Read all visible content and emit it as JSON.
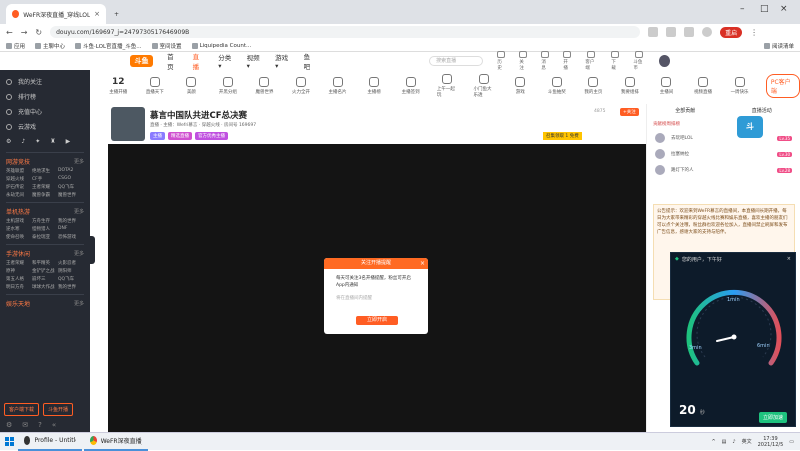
{
  "browser": {
    "tabs": [
      {
        "title": "WeFR深夜直播_穿线LOL比直播_斗鱼",
        "active": false
      },
      {
        "title": "",
        "active": true
      }
    ],
    "url": "douyu.com/169697_j=2479730517646909B",
    "restart_label": "重启",
    "bookmarks": [
      "应用",
      "主聊中心",
      "斗鱼·LOL官直播_斗鱼...",
      "室间设置",
      "Liquipedia Count..."
    ],
    "reading_list": "阅读清单"
  },
  "site": {
    "logo": "斗鱼",
    "nav": [
      {
        "label": "首页",
        "active": false
      },
      {
        "label": "直播",
        "active": true
      },
      {
        "label": "分类▾",
        "active": false
      },
      {
        "label": "视频▾",
        "active": false
      },
      {
        "label": "游戏▾",
        "active": false
      },
      {
        "label": "鱼吧",
        "active": false
      }
    ],
    "search_placeholder": "搜索直播",
    "header_icons": [
      "历史",
      "关注",
      "消息",
      "开播",
      "客户端",
      "下载",
      "斗鱼币"
    ]
  },
  "sidebar": {
    "items": [
      "我的关注",
      "排行榜",
      "充值中心",
      "云游戏"
    ],
    "sections": [
      {
        "title": "网游竞技",
        "more": "更多",
        "items": [
          "英雄联盟",
          "绝地求生",
          "DOTA2",
          "穿越火线",
          "CF手",
          "CSGO",
          "炉石传说",
          "王者荣耀",
          "QQ飞车",
          "永劫无间",
          "魔兽争霸",
          "魔兽世界"
        ]
      },
      {
        "title": "单机热游",
        "more": "更多",
        "items": [
          "主机游戏",
          "方舟生存",
          "我的世界",
          "逆水寒",
          "怪物猎人",
          "DNF",
          "使命召唤",
          "泰拉瑞亚",
          "恐怖游戏"
        ]
      },
      {
        "title": "手游休闲",
        "more": "更多",
        "items": [
          "王者荣耀",
          "和平精英",
          "火影忍者",
          "原神",
          "金铲铲之战",
          "阴阳师",
          "第五人格",
          "崩坏三",
          "QQ飞车",
          "明日方舟",
          "球球大作战",
          "我的世界"
        ]
      },
      {
        "title": "娱乐天地",
        "more": "更多",
        "items": []
      }
    ],
    "buttons": [
      "客户端下载",
      "斗鱼开播"
    ]
  },
  "categories": {
    "count": "12",
    "count_label": "主播开播",
    "items": [
      "直播天下",
      "美颜",
      "开黑分组",
      "魔兽世界",
      "火力全开",
      "主播名片",
      "主播榜",
      "主播签到",
      "上午一起玩",
      "小门鱼大乐透",
      "游戏",
      "斗鱼抽奖",
      "我的主页",
      "我要组排",
      "主播间",
      "视频直播",
      "一周快乐",
      "更多"
    ],
    "pc_button": "PC客户端"
  },
  "room": {
    "title": "慕言中国队共进CF总决赛",
    "subtitle": "直播 · 主播：Wefri慕言 · 穿越火线 · 房间号 169697",
    "tags": [
      "主播",
      "精选直播",
      "官方优秀主播"
    ],
    "banner": "召集领取 1 免费",
    "fans": "4875",
    "follow_label": "+关注"
  },
  "modal": {
    "title": "关注开播提醒",
    "body": "每天可关注3名开播提醒，粉丝可开启App内通知",
    "hint": "将在直播间内提醒",
    "button": "立即开启"
  },
  "right_panel": {
    "tabs": [
      "全部贡献",
      "直播活动"
    ],
    "rank_title": "贡献榜周排榜",
    "rows": [
      {
        "name": "去玩吧LOL",
        "level": "Lv.35"
      },
      {
        "name": "拉塞纳拉",
        "level": "Lv.30"
      },
      {
        "name": "路灯下的人",
        "level": "Lv.28"
      }
    ],
    "notice": "公告提示：欢迎来到WeFR慕言的直播间，本直播间长期开播，每日为大家带来精彩的穿越火线比赛和娱乐直播，喜欢主播的朋友们可以点个关注哦，粉丝群也欢迎各位加入，直播间禁止刷屏和发布广告信息，感谢大家的支持与陪伴。"
  },
  "speed_widget": {
    "title": "您的用户，下午好",
    "close": "×",
    "gauge_labels": [
      "1min",
      "3min",
      "6min"
    ],
    "value": "20",
    "unit": "秒",
    "button": "立即加速"
  },
  "taskbar": {
    "items": [
      {
        "label": "Profile - Untitled -...",
        "color": "#333"
      },
      {
        "label": "WeFR深夜直播_穿...",
        "color": "#4285f4"
      }
    ],
    "tray_text": "英文",
    "time": "17:39",
    "date": "2021/12/5"
  }
}
